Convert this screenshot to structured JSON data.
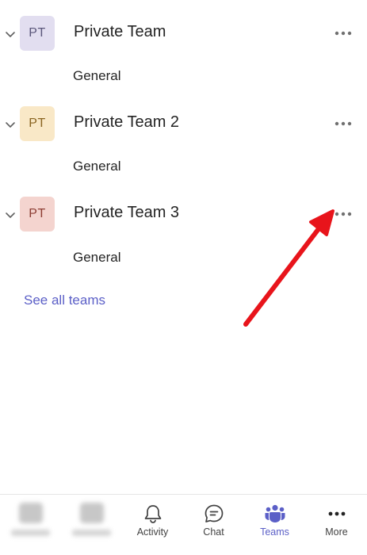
{
  "teams": [
    {
      "name": "Private Team",
      "initials": "PT",
      "avatar_bg": "#e2def0",
      "avatar_fg": "#5a567a",
      "channels": [
        "General"
      ]
    },
    {
      "name": "Private Team 2",
      "initials": "PT",
      "avatar_bg": "#f9e8c7",
      "avatar_fg": "#8a6421",
      "channels": [
        "General"
      ]
    },
    {
      "name": "Private Team 3",
      "initials": "PT",
      "avatar_bg": "#f4d4cf",
      "avatar_fg": "#8c3d33",
      "channels": [
        "General"
      ]
    }
  ],
  "see_all_label": "See all teams",
  "bottom_nav": [
    {
      "label": "",
      "icon": "blurred-icon",
      "blurred": true
    },
    {
      "label": "",
      "icon": "blurred-icon",
      "blurred": true
    },
    {
      "label": "Activity",
      "icon": "bell-icon",
      "active": false
    },
    {
      "label": "Chat",
      "icon": "chat-icon",
      "active": false
    },
    {
      "label": "Teams",
      "icon": "teams-icon",
      "active": true
    },
    {
      "label": "More",
      "icon": "more-icon",
      "active": false
    }
  ],
  "colors": {
    "accent": "#5b5fc7",
    "annotation_arrow": "#e8141b",
    "text": "#242424",
    "muted_icon": "#616161"
  }
}
